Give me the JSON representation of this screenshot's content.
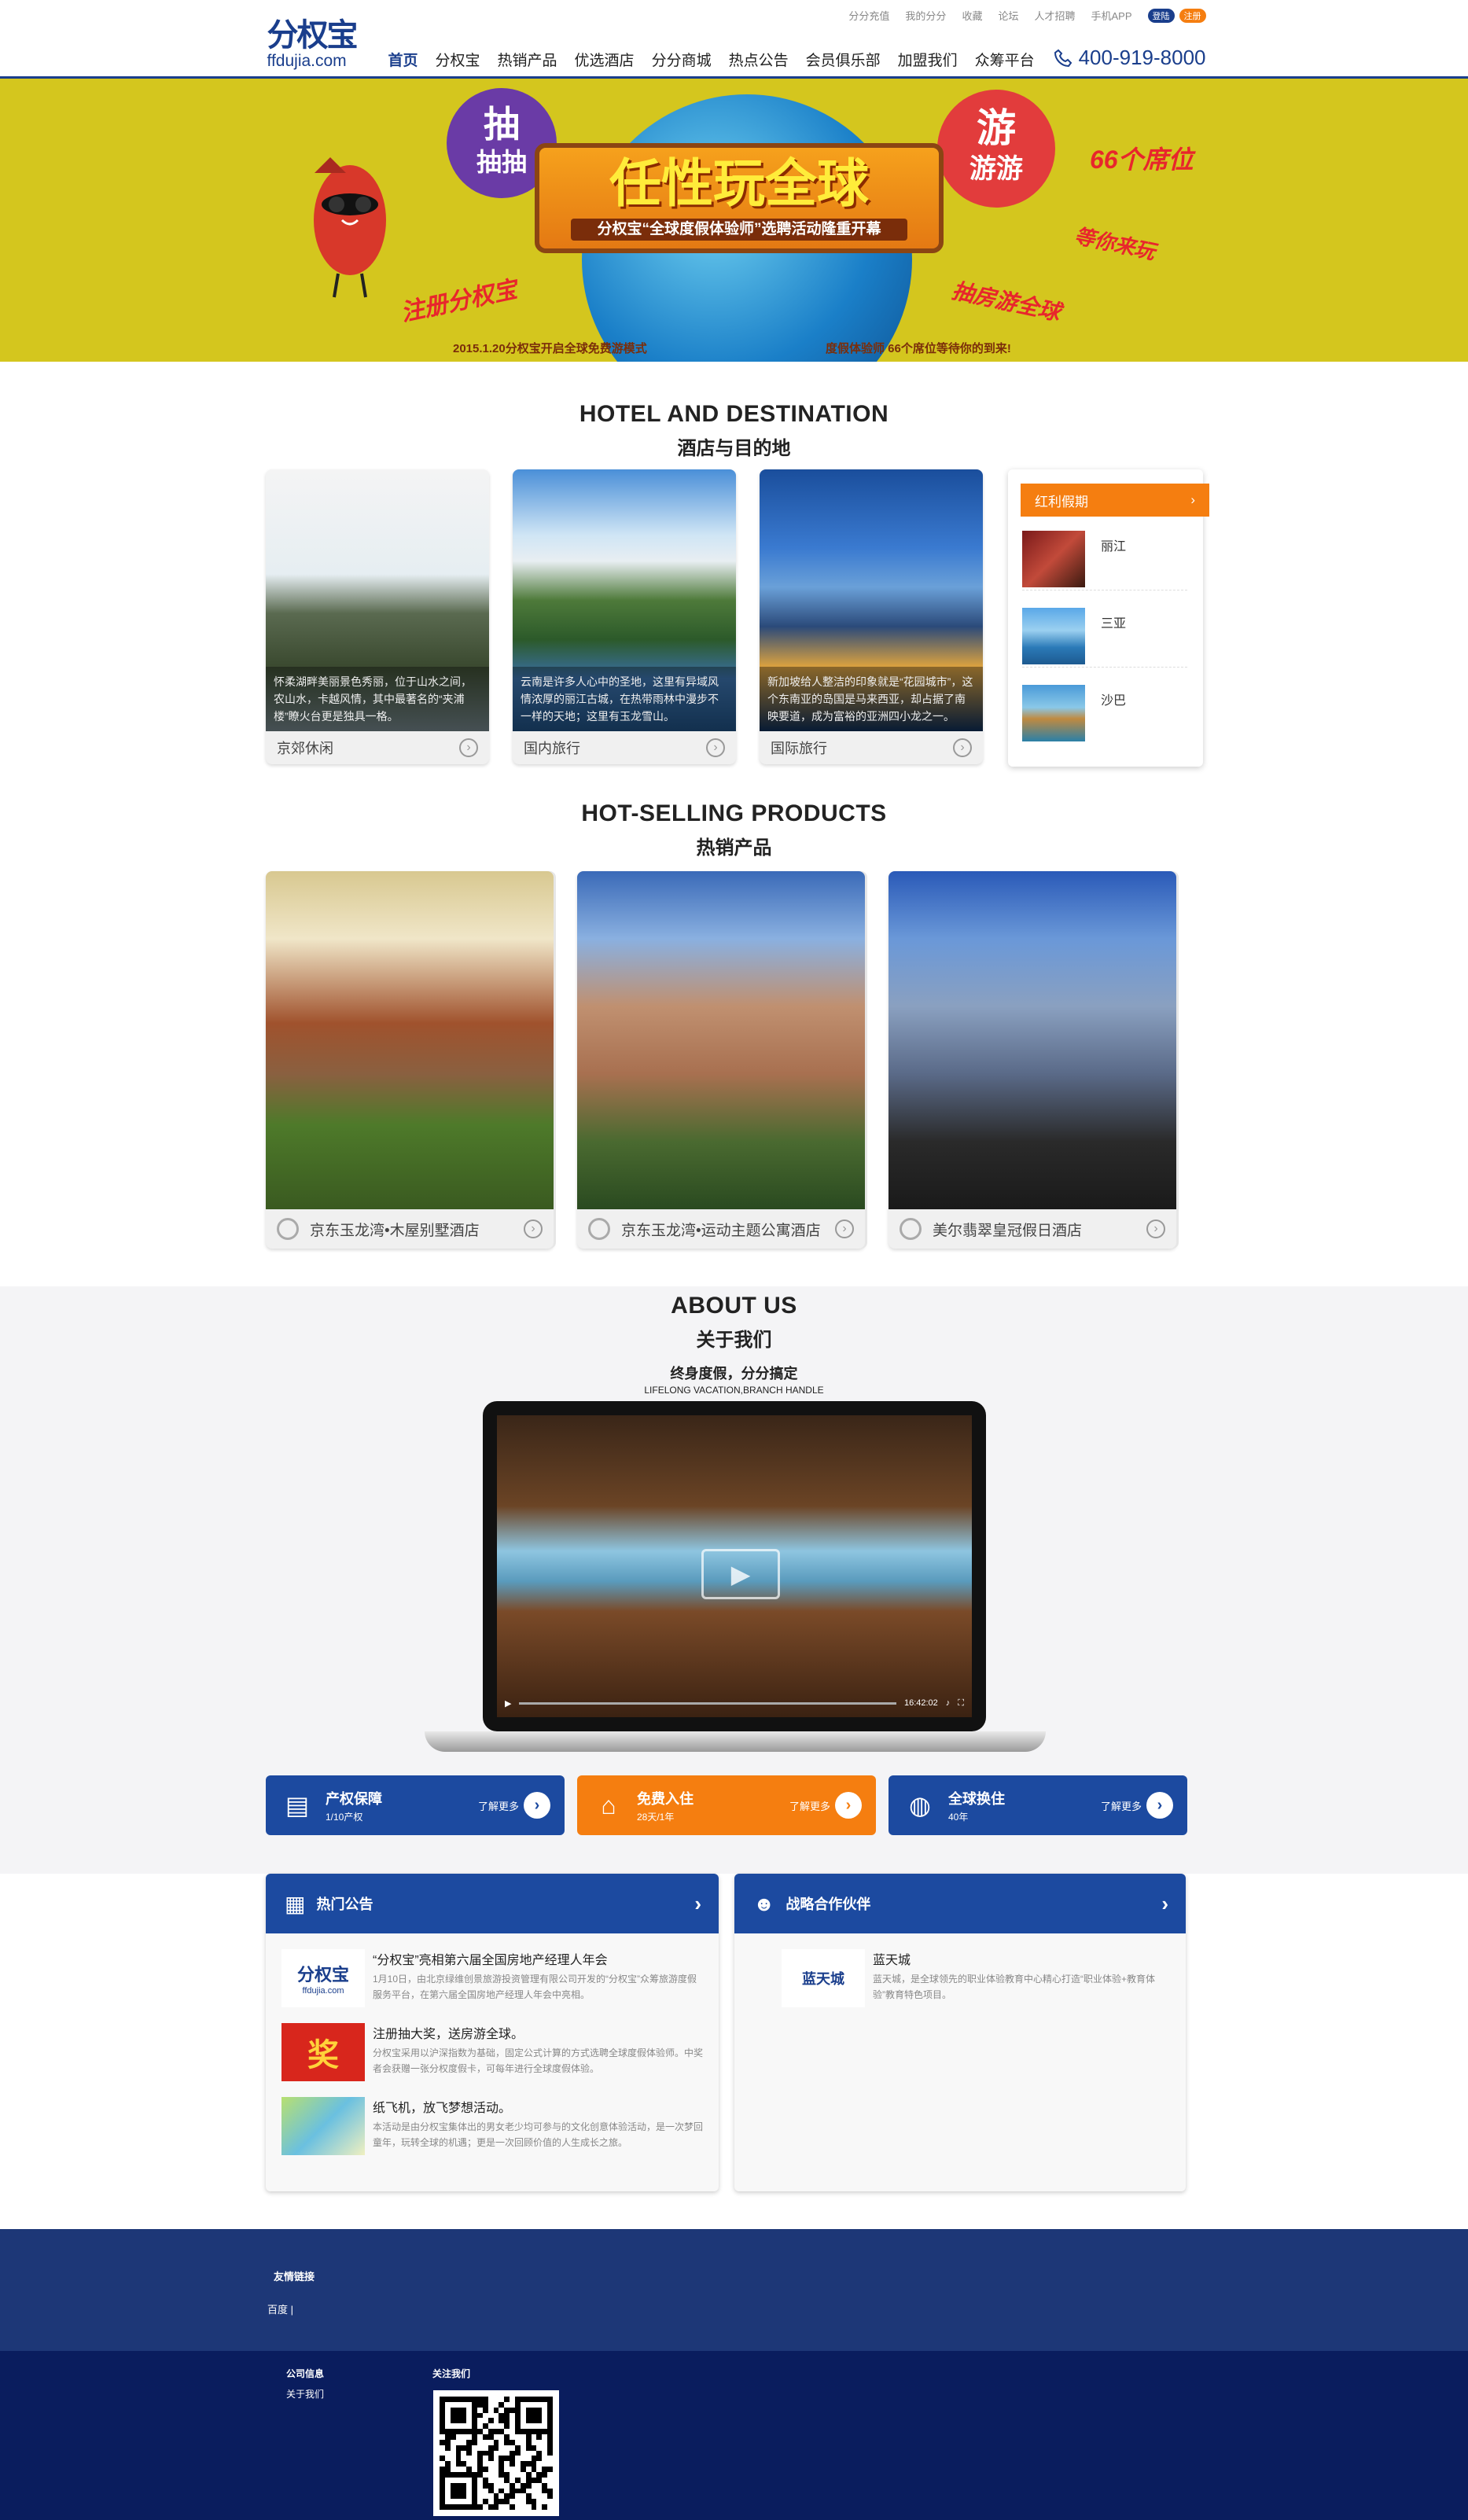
{
  "header": {
    "logo_mark": "分权宝",
    "logo_domain": "ffdujia.com",
    "top_links": [
      "分分充值",
      "我的分分",
      "收藏",
      "论坛",
      "人才招聘",
      "手机APP"
    ],
    "login": "登陆",
    "register": "注册",
    "nav": [
      "首页",
      "分权宝",
      "热销产品",
      "优选酒店",
      "分分商城",
      "热点公告",
      "会员俱乐部",
      "加盟我们",
      "众筹平台"
    ],
    "phone": "400-919-8000"
  },
  "banner": {
    "date": "2015-01-20",
    "main_title": "任性玩全球",
    "sub_title": "分权宝“全球度假体验师”选聘活动隆重开幕",
    "left_badge": [
      "抽",
      "抽抽"
    ],
    "right_badge": [
      "游",
      "游游"
    ],
    "seats": "66个席位",
    "wait": "等你来玩",
    "register_text": "注册分权宝",
    "draw_text": "抽房游全球",
    "bottom_left": "2015.1.20分权宝开启全球免费游模式",
    "bottom_right": "度假体验师 66个席位等待你的到来!"
  },
  "hotel": {
    "title_en": "HOTEL AND DESTINATION",
    "title_cn": "酒店与目的地",
    "cards": [
      {
        "caption": "怀柔湖畔美丽景色秀丽，位于山水之间，农山水，卡越风情，其中最著名的“夹浦楼”瞭火台更是独具一格。",
        "label": "京郊休闲"
      },
      {
        "caption": "云南是许多人心中的圣地，这里有异域风情浓厚的丽江古城，在热带雨林中漫步不一样的天地；这里有玉龙雪山。",
        "label": "国内旅行"
      },
      {
        "caption": "新加坡给人整洁的印象就是“花园城市”，这个东南亚的岛国是马来西亚，却占据了南映要道，成为富裕的亚洲四小龙之一。",
        "label": "国际旅行"
      }
    ],
    "deals": {
      "title": "红利假期",
      "items": [
        "丽江",
        "三亚",
        "沙巴"
      ]
    }
  },
  "products": {
    "title_en": "HOT-SELLING PRODUCTS",
    "title_cn": "热销产品",
    "items": [
      "京东玉龙湾•木屋别墅酒店",
      "京东玉龙湾•运动主题公寓酒店",
      "美尔翡翠皇冠假日酒店"
    ]
  },
  "about": {
    "title_en": "ABOUT US",
    "title_cn": "关于我们",
    "motto": "终身度假，分分搞定",
    "motto_en": "LIFELONG VACATION,BRANCH HANDLE",
    "video_time": "16:42:02",
    "features": [
      {
        "title": "产权保障",
        "sub": "1/10产权",
        "more": "了解更多"
      },
      {
        "title": "免费入住",
        "sub": "28天/1年",
        "more": "了解更多"
      },
      {
        "title": "全球换住",
        "sub": "40年",
        "more": "了解更多"
      }
    ]
  },
  "news": {
    "left_title": "热门公告",
    "right_title": "战略合作伙伴",
    "left_items": [
      {
        "title": "“分权宝”亮相第六届全国房地产经理人年会",
        "desc": "1月10日，由北京绿维创景旅游投资管理有限公司开发的“分权宝”众筹旅游度假服务平台，在第六届全国房地产经理人年会中亮相。"
      },
      {
        "title": "注册抽大奖，送房游全球。",
        "desc": "分权宝采用以沪深指数为基础，固定公式计算的方式选聘全球度假体验师。中奖者会获赠一张分权度假卡，可每年进行全球度假体验。"
      },
      {
        "title": "纸飞机，放飞梦想活动。",
        "desc": "本活动是由分权宝集体出的男女老少均可参与的文化创意体验活动，是一次梦回童年，玩转全球的机遇；更是一次回顾价值的人生成长之旅。"
      }
    ],
    "right_items": [
      {
        "title": "蓝天城",
        "desc": "蓝天城，是全球领先的职业体验教育中心精心打造“职业体验+教育体验”教育特色项目。"
      }
    ],
    "thumb_text": "奖"
  },
  "footer": {
    "friend_links_title": "友情链接",
    "friend_links": "百度 |",
    "company_title": "公司信息",
    "about_link": "关于我们",
    "follow_title": "关注我们"
  },
  "colors": {
    "brand": "#1a3e8c",
    "accent": "#f57e10",
    "banner_bg": "#d4c61e",
    "footer1": "#1d3777",
    "footer2": "#0a1d5e"
  }
}
